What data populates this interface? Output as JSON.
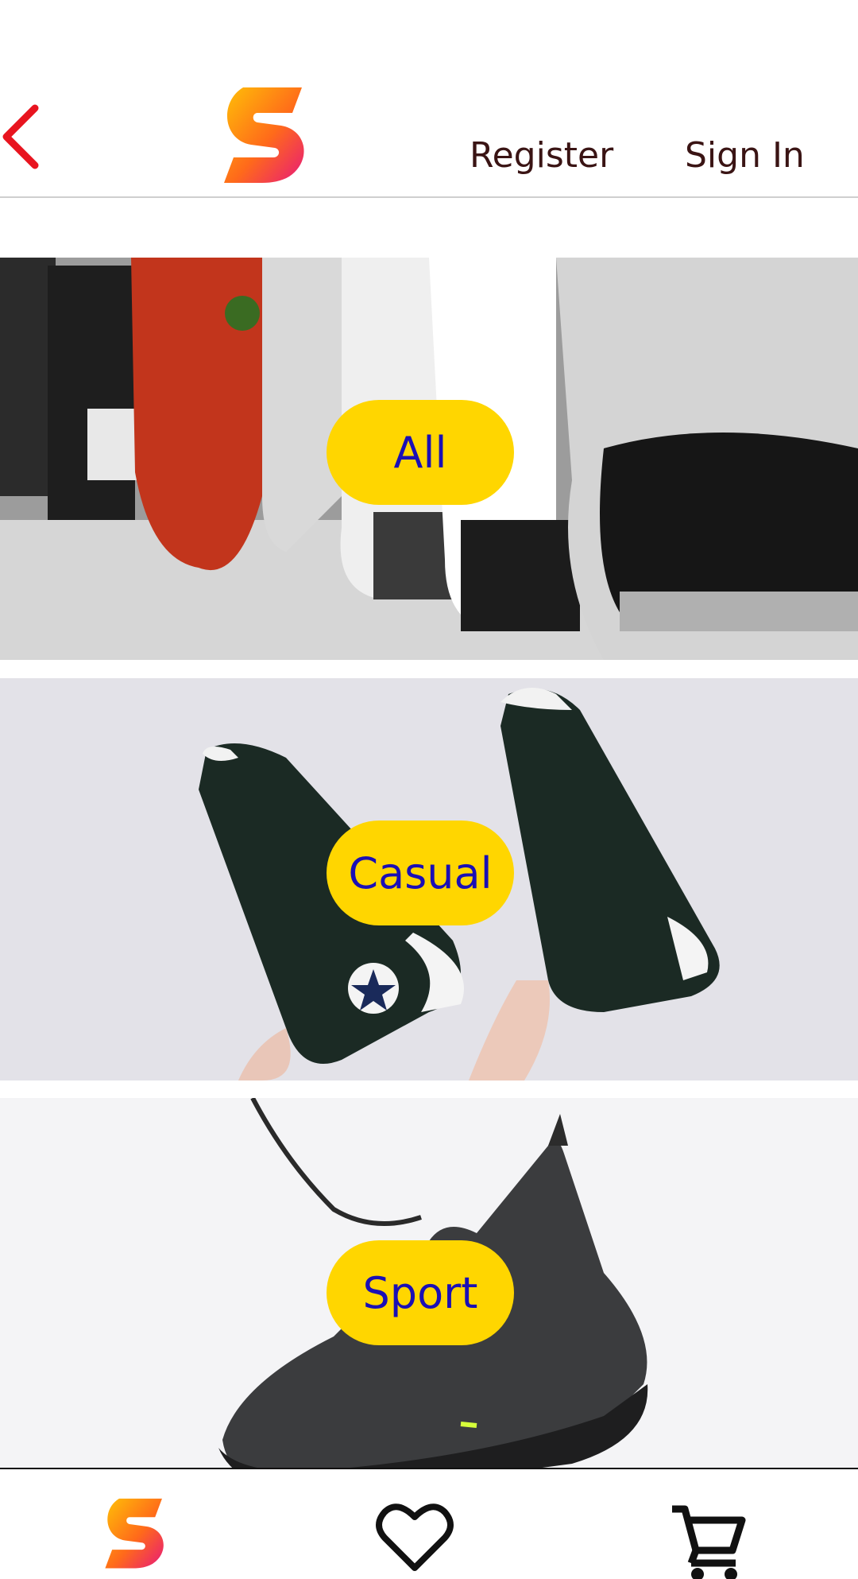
{
  "header": {
    "back_icon": "chevron-left-icon",
    "logo_icon": "s-logo-icon",
    "register_label": "Register",
    "signin_label": "Sign In"
  },
  "categories": [
    {
      "label": "All",
      "image": "sneakers-row-photo"
    },
    {
      "label": "Casual",
      "image": "high-top-sneakers-photo"
    },
    {
      "label": "Sport",
      "image": "running-shoe-photo"
    }
  ],
  "bottom_nav": {
    "items": [
      {
        "icon": "s-logo-icon",
        "name": "home"
      },
      {
        "icon": "heart-icon",
        "name": "favorites"
      },
      {
        "icon": "cart-icon",
        "name": "cart"
      }
    ]
  },
  "colors": {
    "accent_red": "#e8141f",
    "pill_yellow": "#ffd600",
    "pill_text": "#1a0fb5",
    "link_text": "#3a1414",
    "logo_gradient": [
      "#ffc107",
      "#ff6a1a",
      "#e8197a"
    ]
  }
}
